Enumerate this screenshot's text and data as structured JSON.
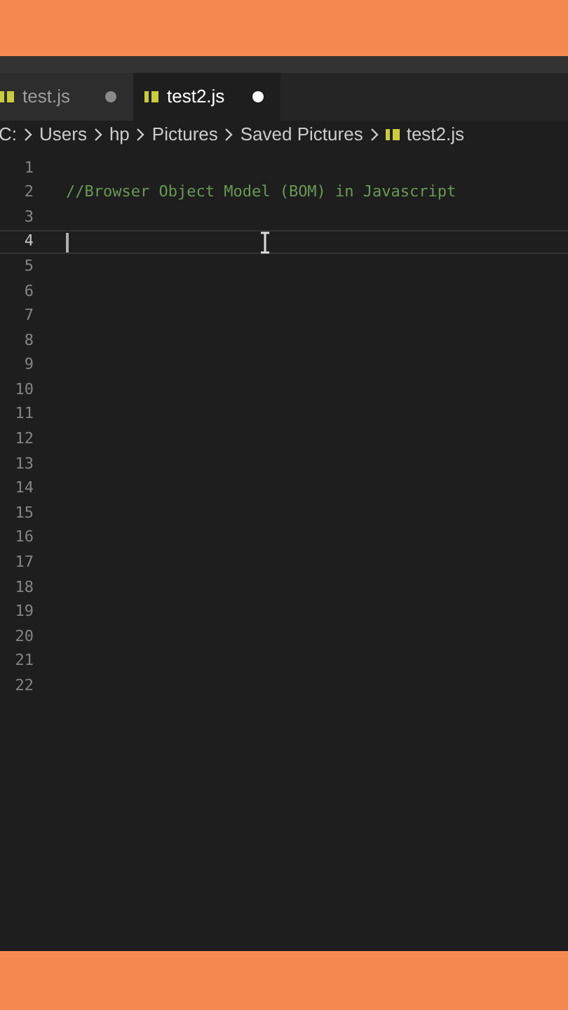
{
  "tabs": [
    {
      "label": "test.js",
      "selected": false,
      "modified": true
    },
    {
      "label": "test2.js",
      "selected": true,
      "modified": true
    }
  ],
  "breadcrumb": [
    {
      "label": "C:",
      "kind": "folder"
    },
    {
      "label": "Users",
      "kind": "folder"
    },
    {
      "label": "hp",
      "kind": "folder"
    },
    {
      "label": "Pictures",
      "kind": "folder"
    },
    {
      "label": "Saved Pictures",
      "kind": "folder"
    },
    {
      "label": "test2.js",
      "kind": "file"
    }
  ],
  "lines": [
    {
      "number": "1",
      "current": false
    },
    {
      "number": "2",
      "current": false,
      "text": "//Browser Object Model (BOM) in Javascript",
      "kind": "comment"
    },
    {
      "number": "3",
      "current": false
    },
    {
      "number": "4",
      "current": true
    },
    {
      "number": "5",
      "current": false
    },
    {
      "number": "6",
      "current": false
    },
    {
      "number": "7",
      "current": false
    },
    {
      "number": "8",
      "current": false
    },
    {
      "number": "9",
      "current": false
    },
    {
      "number": "10",
      "current": false
    },
    {
      "number": "11",
      "current": false
    },
    {
      "number": "12",
      "current": false
    },
    {
      "number": "13",
      "current": false
    },
    {
      "number": "14",
      "current": false
    },
    {
      "number": "15",
      "current": false
    },
    {
      "number": "16",
      "current": false
    },
    {
      "number": "17",
      "current": false
    },
    {
      "number": "18",
      "current": false
    },
    {
      "number": "19",
      "current": false
    },
    {
      "number": "20",
      "current": false
    },
    {
      "number": "21",
      "current": false
    },
    {
      "number": "22",
      "current": false
    }
  ]
}
